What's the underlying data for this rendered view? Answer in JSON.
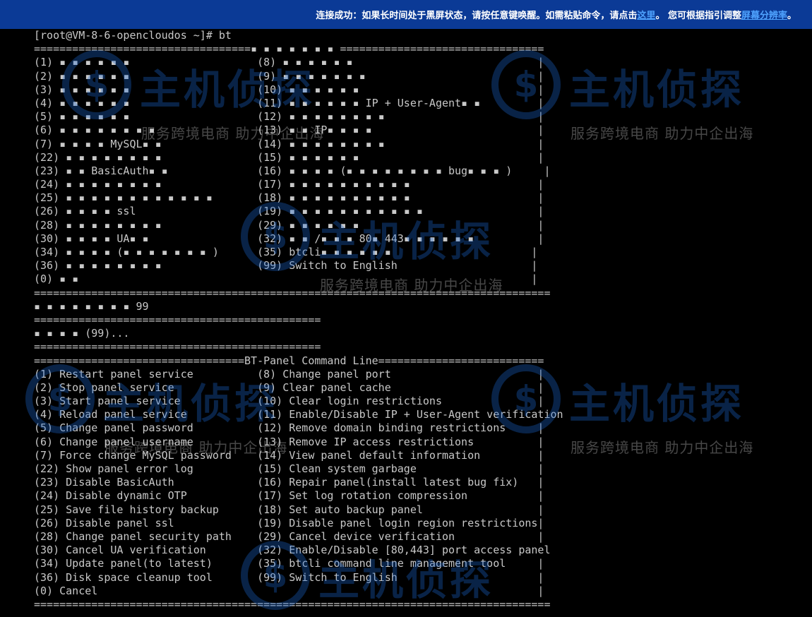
{
  "banner": {
    "text_before_link": "连接成功：如果长时间处于黑屏状态，请按任意键唤醒。如需粘贴命令，请点击",
    "link_here": "这里",
    "text_middle": "。 您可根据指引调整",
    "link_resolution": "屏幕分辨率",
    "text_end": "。"
  },
  "terminal": {
    "lines": [
      "[root@VM-8-6-opencloudos ~]# bt",
      "==================================▪ ▪ ▪ ▪ ▪ ▪ ▪ ================================",
      "(1) ▪ ▪ ▪ ▪ ▪ ▪                    (8) ▪ ▪ ▪ ▪ ▪ ▪                             |",
      "(2) ▪ ▪ ▪ ▪ ▪ ▪                    (9) ▪ ▪ ▪ ▪ ▪ ▪ ▪                           |",
      "(3) ▪ ▪ ▪ ▪ ▪ ▪                    (10) ▪ ▪ ▪ ▪ ▪ ▪                            |",
      "(4) ▪ ▪ ▪ ▪ ▪ ▪                    (11) ▪ ▪ ▪ ▪ ▪ ▪ IP + User-Agent▪ ▪         |",
      "(5) ▪ ▪ ▪ ▪ ▪ ▪                    (12) ▪ ▪ ▪ ▪ ▪ ▪ ▪ ▪                        |",
      "(6) ▪ ▪ ▪ ▪ ▪ ▪ ▪ ▪                (13) ▪ ▪ IP▪ ▪ ▪ ▪                          |",
      "(7) ▪ ▪ ▪ ▪ MySQL▪ ▪               (14) ▪ ▪ ▪ ▪ ▪ ▪ ▪ ▪                        |",
      "(22) ▪ ▪ ▪ ▪ ▪ ▪ ▪ ▪               (15) ▪ ▪ ▪ ▪ ▪ ▪                            |",
      "(23) ▪ ▪ BasicAuth▪ ▪              (16) ▪ ▪ ▪ ▪ (▪ ▪ ▪ ▪ ▪ ▪ ▪ ▪ bug▪ ▪ ▪ )     |",
      "(24) ▪ ▪ ▪ ▪ ▪ ▪ ▪ ▪               (17) ▪ ▪ ▪ ▪ ▪ ▪ ▪ ▪ ▪ ▪                    |",
      "(25) ▪ ▪ ▪ ▪ ▪ ▪ ▪ ▪ ▪ ▪ ▪ ▪       (18) ▪ ▪ ▪ ▪ ▪ ▪ ▪ ▪ ▪ ▪                    |",
      "(26) ▪ ▪ ▪ ▪ ssl                   (19) ▪ ▪ ▪ ▪ ▪ ▪ ▪ ▪ ▪ ▪ ▪                  |",
      "(28) ▪ ▪ ▪ ▪ ▪ ▪ ▪ ▪               (29) ▪ ▪ ▪ ▪ ▪ ▪                            |",
      "(30) ▪ ▪ ▪ ▪ UA▪ ▪                 (32) ▪ ▪ /▪ ▪ ▪ 80▪ 443▪ ▪ ▪ ▪ ▪ ▪          |",
      "(34) ▪ ▪ ▪ ▪ (▪ ▪ ▪ ▪ ▪ ▪ ▪ )      (35) btcli▪ ▪ ▪ ▪ ▪ ▪                      |",
      "(36) ▪ ▪ ▪ ▪ ▪ ▪ ▪ ▪               (99) Switch to English                     |",
      "(0) ▪ ▪                                                                       |",
      "=================================================================================",
      "▪ ▪ ▪ ▪ ▪ ▪ ▪ ▪ 99",
      "=============================================",
      "▪ ▪ ▪ ▪ (99)...",
      "=============================================",
      "=================================BT-Panel Command Line==========================",
      "(1) Restart panel service          (8) Change panel port                       |",
      "(2) Stop panel service             (9) Clear panel cache                       |",
      "(3) Start panel service            (10) Clear login restrictions               |",
      "(4) Reload panel service           (11) Enable/Disable IP + User-Agent verification",
      "(5) Change panel password          (12) Remove domain binding restrictions     |",
      "(6) Change panel username          (13) Remove IP access restrictions          |",
      "(7) Force change MySQL password    (14) View panel default information         |",
      "(22) Show panel error log          (15) Clean system garbage                   |",
      "(23) Disable BasicAuth             (16) Repair panel(install latest bug fix)   |",
      "(24) Disable dynamic OTP           (17) Set log rotation compression           |",
      "(25) Save file history backup      (18) Set auto backup panel                  |",
      "(26) Disable panel ssl             (19) Disable panel login region restrictions|",
      "(28) Change panel security path    (29) Cancel device verification             |",
      "(30) Cancel UA verification        (32) Enable/Disable [80,443] port access panel",
      "(34) Update panel(to latest)       (35) btcli command line management tool     |",
      "(36) Disk space cleanup tool       (99) Switch to English                      |",
      "(0) Cancel                                                                     |",
      "================================================================================="
    ]
  },
  "watermark": {
    "brand": "主机侦探",
    "slogan": "服务跨境电商 助力中企出海",
    "logo_icon": "globe-dollar-icon"
  },
  "colors": {
    "banner_bg": "#0b3a96",
    "banner_link": "#4fa3ff",
    "terminal_bg": "#000000",
    "terminal_text": "#c8c8c8",
    "watermark_blue": "#1d6cd8"
  }
}
